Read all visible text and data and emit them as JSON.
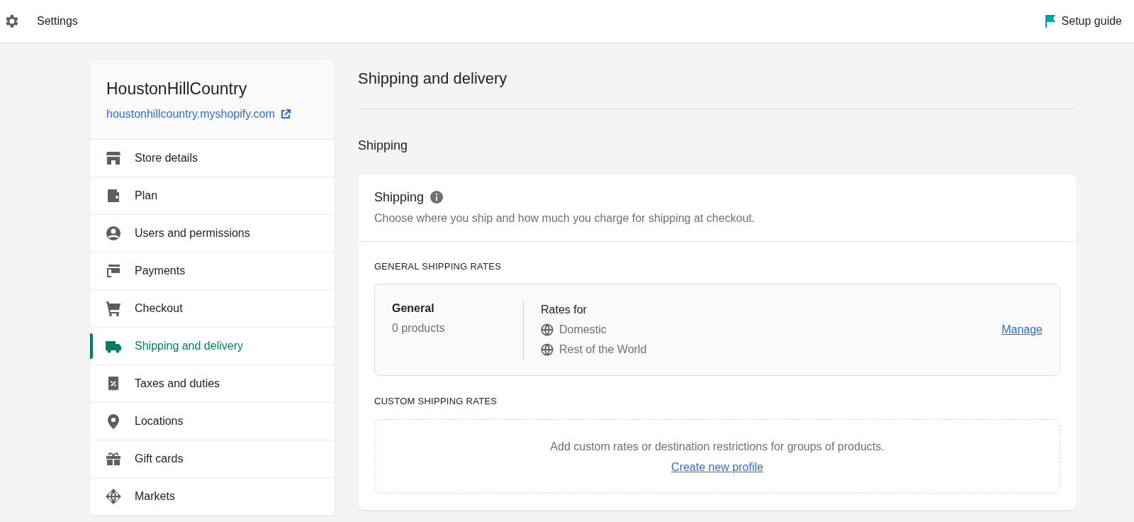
{
  "top_bar": {
    "title": "Settings",
    "setup_guide": "Setup guide"
  },
  "sidebar": {
    "store_name": "HoustonHillCountry",
    "store_url": "houstonhillcountry.myshopify.com",
    "items": [
      {
        "label": "Store details",
        "selected": false
      },
      {
        "label": "Plan",
        "selected": false
      },
      {
        "label": "Users and permissions",
        "selected": false
      },
      {
        "label": "Payments",
        "selected": false
      },
      {
        "label": "Checkout",
        "selected": false
      },
      {
        "label": "Shipping and delivery",
        "selected": true
      },
      {
        "label": "Taxes and duties",
        "selected": false
      },
      {
        "label": "Locations",
        "selected": false
      },
      {
        "label": "Gift cards",
        "selected": false
      },
      {
        "label": "Markets",
        "selected": false
      }
    ]
  },
  "page_title": "Shipping and delivery",
  "section_title": "Shipping",
  "shipping_card": {
    "title": "Shipping",
    "description": "Choose where you ship and how much you charge for shipping at checkout.",
    "general_heading": "GENERAL SHIPPING RATES",
    "general_profile": {
      "name": "General",
      "count": "0 products",
      "rates_label": "Rates for",
      "zones": [
        "Domestic",
        "Rest of the World"
      ],
      "action": "Manage"
    },
    "custom_heading": "CUSTOM SHIPPING RATES",
    "custom_text": "Add custom rates or destination restrictions for groups of products.",
    "custom_action": "Create new profile"
  }
}
